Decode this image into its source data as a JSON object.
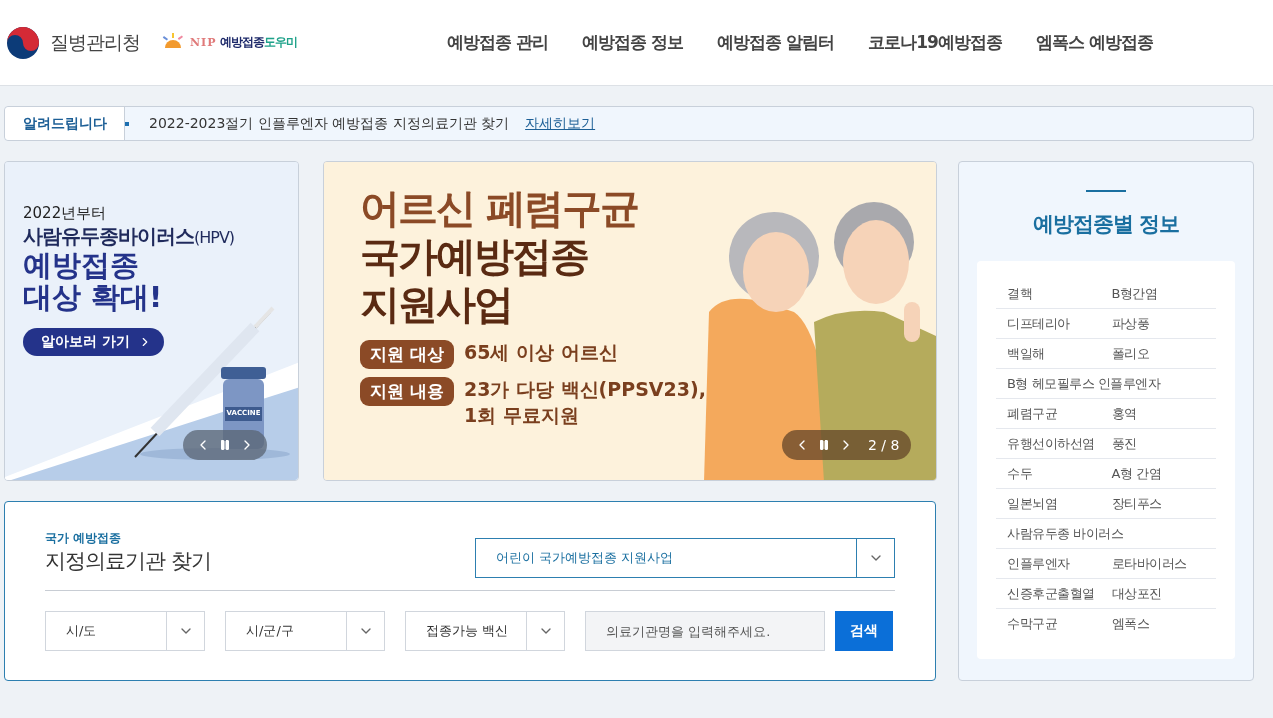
{
  "header": {
    "agency": "질병관리청",
    "service_logo": {
      "badge": "NIP",
      "name_dark": "예방접종",
      "name_accent": "도우미"
    },
    "nav": [
      "예방접종 관리",
      "예방접종 정보",
      "예방접종 알림터",
      "코로나19예방접종",
      "엠폭스 예방접종"
    ]
  },
  "notice": {
    "label": "알려드립니다",
    "text": "2022-2023절기 인플루엔자 예방접종 지정의료기관 찾기",
    "link": "자세히보기"
  },
  "side_banner": {
    "kicker": "2022년부터",
    "title_main": "사람유두종바이러스",
    "title_suffix": "(HPV)",
    "headline": [
      "예방접종",
      "대상 확대!"
    ],
    "button": "알아보러 가기",
    "vial_label": "VACCINE"
  },
  "main_banner": {
    "title": [
      "어르신 폐렴구균",
      "국가예방접종",
      "지원사업"
    ],
    "details": [
      {
        "tag": "지원 대상",
        "text": [
          "65세 이상 어르신"
        ]
      },
      {
        "tag": "지원 내용",
        "text": [
          "23가 다당 백신(PPSV23),",
          "1회 무료지원"
        ]
      }
    ],
    "counter": "2 / 8"
  },
  "vaccine_panel": {
    "title": "예방접종별 정보",
    "rows": [
      [
        "결핵",
        "B형간염"
      ],
      [
        "디프테리아",
        "파상풍"
      ],
      [
        "백일해",
        "폴리오"
      ],
      [
        "B형 헤모필루스 인플루엔자"
      ],
      [
        "폐렴구균",
        "홍역"
      ],
      [
        "유행선이하선염",
        "풍진"
      ],
      [
        "수두",
        "A형 간염"
      ],
      [
        "일본뇌염",
        "장티푸스"
      ],
      [
        "사람유두종 바이러스"
      ],
      [
        "인플루엔자",
        "로타바이러스"
      ],
      [
        "신증후군출혈열",
        "대상포진"
      ],
      [
        "수막구균",
        "엠폭스"
      ]
    ]
  },
  "clinic_search": {
    "kicker": "국가 예방접종",
    "title": "지정의료기관 찾기",
    "program": "어린이 국가예방접종 지원사업",
    "filters": [
      "시/도",
      "시/군/구",
      "접종가능 백신"
    ],
    "search": {
      "placeholder": "의료기관명을 입력해주세요."
    },
    "button": "검색"
  }
}
